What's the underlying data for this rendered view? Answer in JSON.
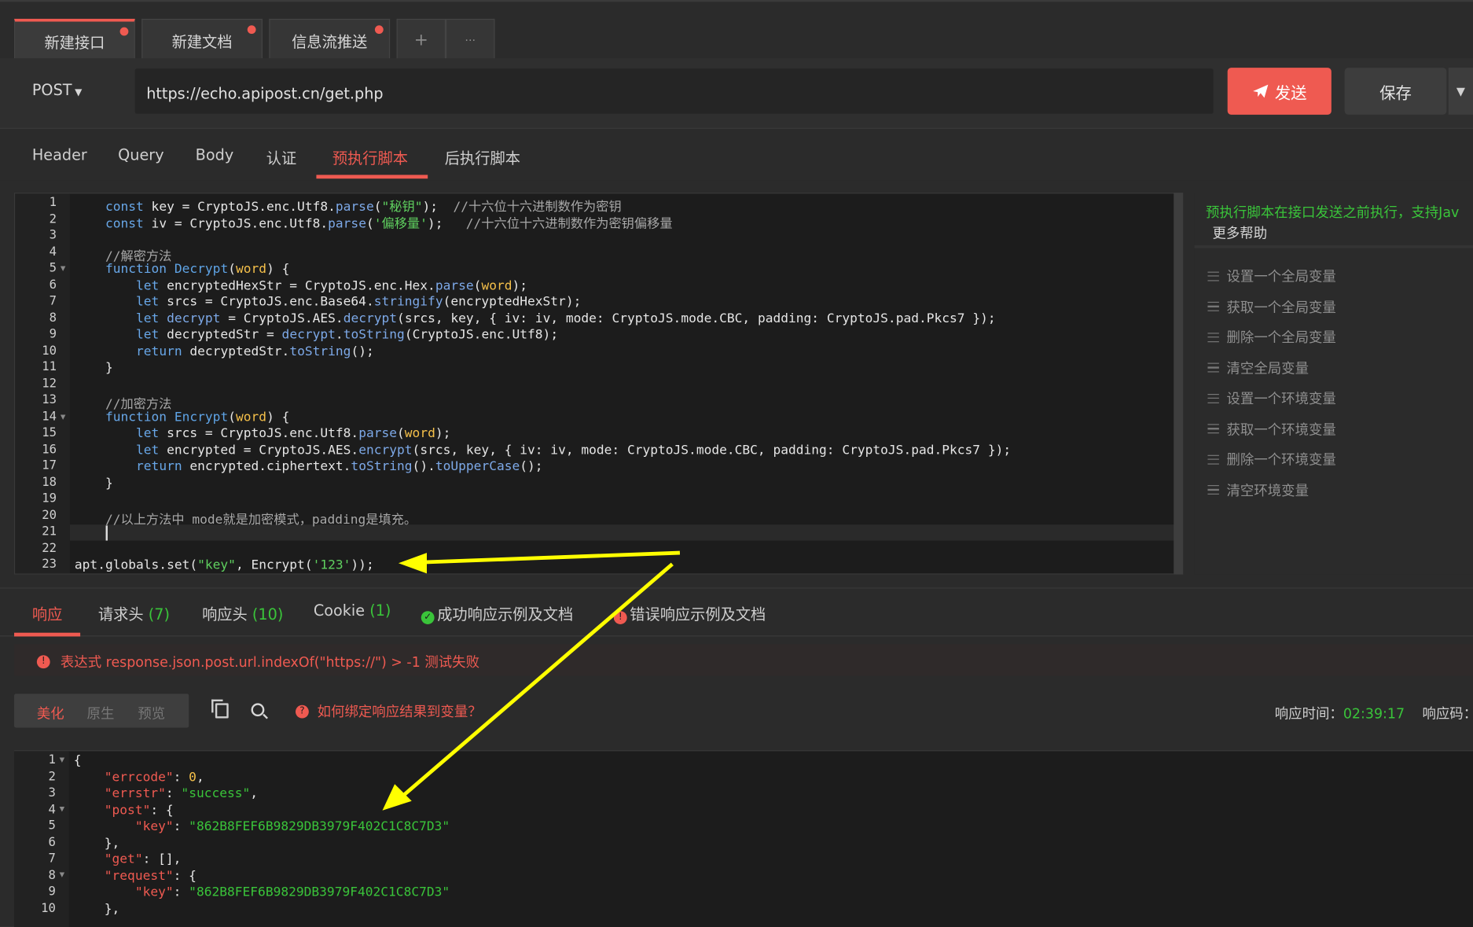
{
  "tabs": [
    {
      "label": "新建接口",
      "active": true,
      "dot": true
    },
    {
      "label": "新建文档",
      "active": false,
      "dot": true
    },
    {
      "label": "信息流推送",
      "active": false,
      "dot": true
    },
    {
      "label": "+",
      "icon": "plus-icon"
    },
    {
      "label": "···",
      "icon": "more-icon"
    }
  ],
  "request": {
    "method": "POST",
    "url": "https://echo.apipost.cn/get.php",
    "send_label": "发送",
    "save_label": "保存"
  },
  "sub_tabs": [
    "Header",
    "Query",
    "Body",
    "认证",
    "预执行脚本",
    "后执行脚本"
  ],
  "active_sub_tab": "预执行脚本",
  "editor": {
    "line_numbers": [
      "1",
      "2",
      "3",
      "4",
      "5",
      "6",
      "7",
      "8",
      "9",
      "10",
      "11",
      "12",
      "13",
      "14",
      "15",
      "16",
      "17",
      "18",
      "19",
      "20",
      "21",
      "22",
      "23"
    ],
    "lines": [
      "    const key = CryptoJS.enc.Utf8.parse(\"秘钥\");  //十六位十六进制数作为密钥",
      "    const iv = CryptoJS.enc.Utf8.parse('偏移量');   //十六位十六进制数作为密钥偏移量",
      "",
      "    //解密方法",
      "    function Decrypt(word) {",
      "        let encryptedHexStr = CryptoJS.enc.Hex.parse(word);",
      "        let srcs = CryptoJS.enc.Base64.stringify(encryptedHexStr);",
      "        let decrypt = CryptoJS.AES.decrypt(srcs, key, { iv: iv, mode: CryptoJS.mode.CBC, padding: CryptoJS.pad.Pkcs7 });",
      "        let decryptedStr = decrypt.toString(CryptoJS.enc.Utf8);",
      "        return decryptedStr.toString();",
      "    }",
      "",
      "    //加密方法",
      "    function Encrypt(word) {",
      "        let srcs = CryptoJS.enc.Utf8.parse(word);",
      "        let encrypted = CryptoJS.AES.encrypt(srcs, key, { iv: iv, mode: CryptoJS.mode.CBC, padding: CryptoJS.pad.Pkcs7 });",
      "        return encrypted.ciphertext.toString().toUpperCase();",
      "    }",
      "",
      "    //以上方法中 mode就是加密模式，padding是填充。",
      "",
      "",
      "apt.globals.set(\"key\", Encrypt('123'));"
    ]
  },
  "help": {
    "title": "预执行脚本在接口发送之前执行，支持Jav",
    "more": "更多帮助",
    "items": [
      "设置一个全局变量",
      "获取一个全局变量",
      "删除一个全局变量",
      "清空全局变量",
      "设置一个环境变量",
      "获取一个环境变量",
      "删除一个环境变量",
      "清空环境变量"
    ]
  },
  "response_tabs": {
    "resp": "响应",
    "req_headers": "请求头",
    "req_headers_count": "(7)",
    "resp_headers": "响应头",
    "resp_headers_count": "(10)",
    "cookie": "Cookie",
    "cookie_count": "(1)",
    "success_doc": "成功响应示例及文档",
    "error_doc": "错误响应示例及文档"
  },
  "error_message": "表达式 response.json.post.url.indexOf(\"https://\") > -1 测试失败",
  "view_modes": [
    "美化",
    "原生",
    "预览"
  ],
  "active_view_mode": "美化",
  "bind_help": "如何绑定响应结果到变量？",
  "resp_time_label": "响应时间：",
  "resp_time_value": "02:39:17",
  "resp_code_label": "响应码：",
  "response_body": {
    "line_numbers": [
      "1",
      "2",
      "3",
      "4",
      "5",
      "6",
      "7",
      "8",
      "9",
      "10"
    ],
    "errcode_key": "\"errcode\"",
    "errcode_val": "0",
    "errstr_key": "\"errstr\"",
    "errstr_val": "\"success\"",
    "post_key": "\"post\"",
    "key_key": "\"key\"",
    "key_val": "\"862B8FEF6B9829DB3979F402C1C8C7D3\"",
    "get_key": "\"get\"",
    "request_key": "\"request\""
  },
  "colors": {
    "accent": "#ef5a51",
    "success": "#3ac43a",
    "string": "#5fd05f",
    "keyword": "#68a7e8",
    "param": "#f5c04a",
    "annotation_box": "#e53935",
    "arrow": "#ffff00"
  }
}
